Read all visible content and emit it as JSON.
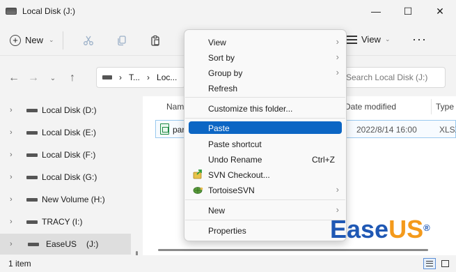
{
  "window": {
    "title": "Local Disk (J:)",
    "controls": {
      "minimize": "—",
      "maximize": "☐",
      "close": "✕"
    }
  },
  "toolbar": {
    "new_label": "New",
    "view_label": "View",
    "more_label": "···"
  },
  "address": {
    "segments": [
      "T...",
      "Loc..."
    ],
    "search_placeholder": "Search Local Disk (J:)"
  },
  "sidebar": {
    "items": [
      {
        "label": "Local Disk (D:)",
        "selected": false
      },
      {
        "label": "Local Disk (E:)",
        "selected": false
      },
      {
        "label": "Local Disk (F:)",
        "selected": false
      },
      {
        "label": "Local Disk (G:)",
        "selected": false
      },
      {
        "label": "New Volume (H:)",
        "selected": false
      },
      {
        "label": "TRACY (I:)",
        "selected": false
      },
      {
        "label": "EaseUS",
        "drive": "(J:)",
        "selected": true
      }
    ]
  },
  "content": {
    "columns": {
      "name": "Name",
      "date": "Date modified",
      "type": "Type"
    },
    "files": [
      {
        "name": "par",
        "date": "2022/8/14 16:00",
        "type": "XLSX"
      }
    ]
  },
  "context_menu": {
    "items": [
      {
        "label": "View",
        "submenu": true
      },
      {
        "label": "Sort by",
        "submenu": true
      },
      {
        "label": "Group by",
        "submenu": true
      },
      {
        "label": "Refresh"
      },
      {
        "label": "Customize this folder..."
      },
      {
        "label": "Paste",
        "highlighted": true
      },
      {
        "label": "Paste shortcut"
      },
      {
        "label": "Undo Rename",
        "shortcut": "Ctrl+Z"
      },
      {
        "label": "SVN Checkout...",
        "icon": "svn-checkout-icon"
      },
      {
        "label": "TortoiseSVN",
        "icon": "tortoisesvn-icon",
        "submenu": true
      },
      {
        "label": "New",
        "submenu": true
      },
      {
        "label": "Properties"
      }
    ]
  },
  "status": {
    "item_count": "1 item"
  },
  "watermark": {
    "ease": "Ease",
    "us": "US",
    "reg": "®"
  },
  "colors": {
    "highlight": "#0c66c4",
    "easeus_blue": "#1f58b4",
    "easeus_orange": "#f49a1b"
  }
}
